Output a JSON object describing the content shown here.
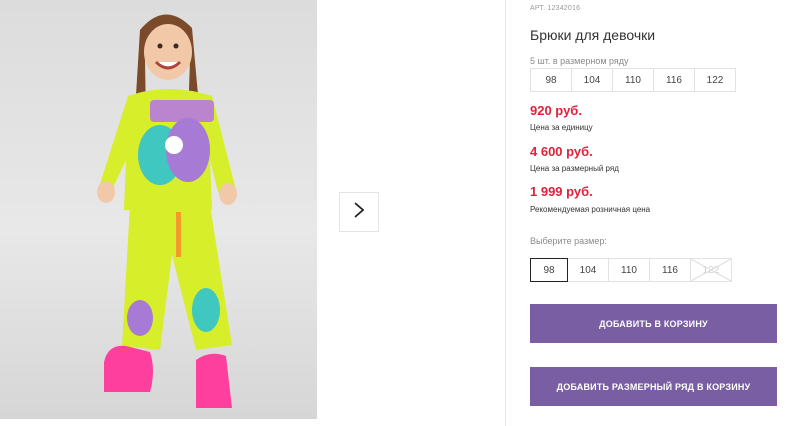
{
  "gallery": {
    "next_icon": "chevron-right-icon"
  },
  "product": {
    "article": "АРТ. 12342016",
    "title": "Брюки для девочки",
    "row_label": "5 шт. в размерном ряду",
    "row_sizes": [
      "98",
      "104",
      "110",
      "116",
      "122"
    ],
    "prices": [
      {
        "value": "920 руб.",
        "caption": "Цена за единицу"
      },
      {
        "value": "4 600 руб.",
        "caption": "Цена за размерный ряд"
      },
      {
        "value": "1 999 руб.",
        "caption": "Рекомендуемая розничная цена"
      }
    ],
    "choose_label": "Выберите размер:",
    "choose_sizes": [
      {
        "label": "98",
        "state": "selected"
      },
      {
        "label": "104",
        "state": "available"
      },
      {
        "label": "110",
        "state": "available"
      },
      {
        "label": "116",
        "state": "available"
      },
      {
        "label": "122",
        "state": "disabled"
      }
    ],
    "add_to_cart": "ДОБАВИТЬ В КОРЗИНУ",
    "add_row_to_cart": "ДОБАВИТЬ РАЗМЕРНЫЙ РЯД В КОРЗИНУ"
  },
  "colors": {
    "accent": "#7a5ea3",
    "price": "#e0213b",
    "outfit": "#d7ee2a",
    "shoes": "#ff3f9e"
  }
}
